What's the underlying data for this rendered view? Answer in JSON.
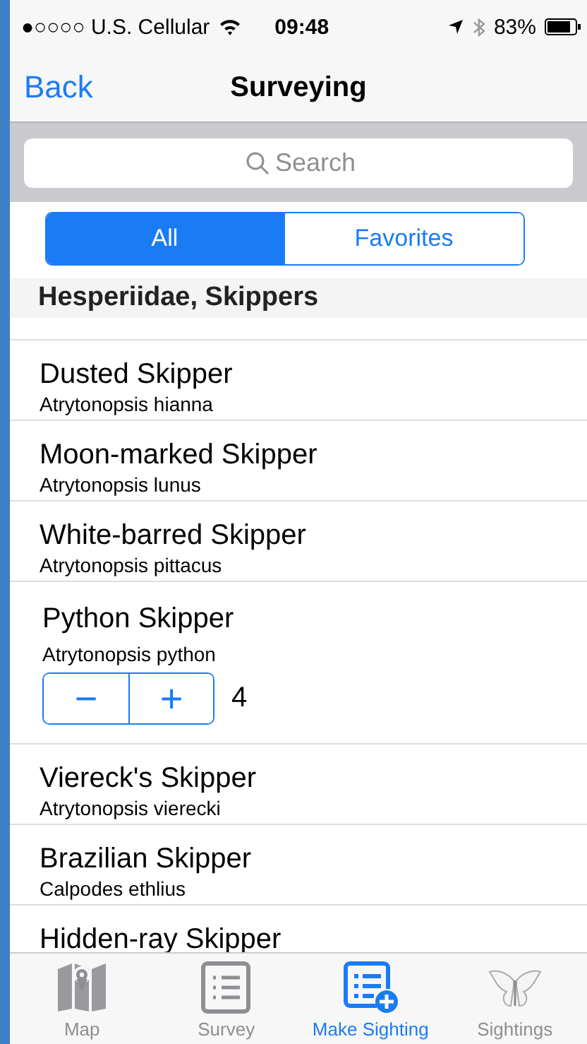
{
  "status_bar": {
    "carrier": "●○○○○ U.S. Cellular",
    "time": "09:48",
    "battery": "83%"
  },
  "nav": {
    "back": "Back",
    "title": "Surveying"
  },
  "search": {
    "placeholder": "Search"
  },
  "segments": [
    {
      "label": "All",
      "selected": true
    },
    {
      "label": "Favorites",
      "selected": false
    }
  ],
  "section": "Hesperiidae, Skippers",
  "rows": [
    {
      "kind": "species",
      "name": "Dusted Skipper",
      "latin": "Atrytonopsis hianna"
    },
    {
      "kind": "species",
      "name": "Moon-marked Skipper",
      "latin": "Atrytonopsis lunus"
    },
    {
      "kind": "species",
      "name": "White-barred Skipper",
      "latin": "Atrytonopsis pittacus"
    },
    {
      "kind": "counter",
      "name": "Python Skipper",
      "latin": "Atrytonopsis python",
      "minus": "−",
      "plus": "+",
      "count": "4"
    },
    {
      "kind": "species",
      "name": "Viereck's Skipper",
      "latin": "Atrytonopsis vierecki"
    },
    {
      "kind": "species",
      "name": "Brazilian Skipper",
      "latin": "Calpodes ethlius"
    },
    {
      "kind": "species",
      "name": "Hidden-ray Skipper"
    }
  ],
  "tabs": [
    {
      "kind": "map",
      "label": "Map",
      "selected": false
    },
    {
      "kind": "survey",
      "label": "Survey",
      "selected": false
    },
    {
      "kind": "sighting",
      "label": "Make Sighting",
      "selected": true
    },
    {
      "kind": "butterfly",
      "label": "Sightings",
      "selected": false
    }
  ]
}
